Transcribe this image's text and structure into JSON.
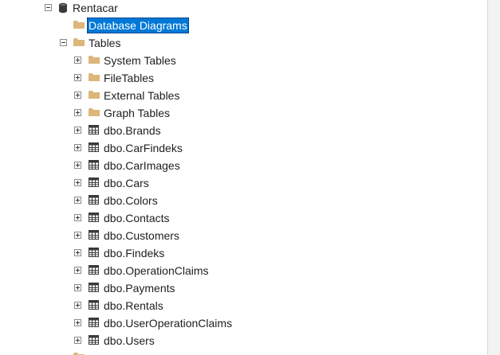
{
  "tree": {
    "root": {
      "label": "Rentacar",
      "icon": "database-icon"
    },
    "db_diagrams": {
      "label": "Database Diagrams",
      "icon": "folder-icon",
      "selected": true
    },
    "tables": {
      "label": "Tables",
      "icon": "folder-icon"
    },
    "system_folders": [
      {
        "label": "System Tables",
        "icon": "folder-icon"
      },
      {
        "label": "FileTables",
        "icon": "folder-icon"
      },
      {
        "label": "External Tables",
        "icon": "folder-icon"
      },
      {
        "label": "Graph Tables",
        "icon": "folder-icon"
      }
    ],
    "table_items": [
      {
        "label": "dbo.Brands",
        "icon": "table-icon"
      },
      {
        "label": "dbo.CarFindeks",
        "icon": "table-icon"
      },
      {
        "label": "dbo.CarImages",
        "icon": "table-icon"
      },
      {
        "label": "dbo.Cars",
        "icon": "table-icon"
      },
      {
        "label": "dbo.Colors",
        "icon": "table-icon"
      },
      {
        "label": "dbo.Contacts",
        "icon": "table-icon"
      },
      {
        "label": "dbo.Customers",
        "icon": "table-icon"
      },
      {
        "label": "dbo.Findeks",
        "icon": "table-icon"
      },
      {
        "label": "dbo.OperationClaims",
        "icon": "table-icon"
      },
      {
        "label": "dbo.Payments",
        "icon": "table-icon"
      },
      {
        "label": "dbo.Rentals",
        "icon": "table-icon"
      },
      {
        "label": "dbo.UserOperationClaims",
        "icon": "table-icon"
      },
      {
        "label": "dbo.Users",
        "icon": "table-icon"
      }
    ]
  },
  "colors": {
    "selection": "#0078d7",
    "folder": "#dcb67a",
    "text": "#1e1e1e"
  }
}
